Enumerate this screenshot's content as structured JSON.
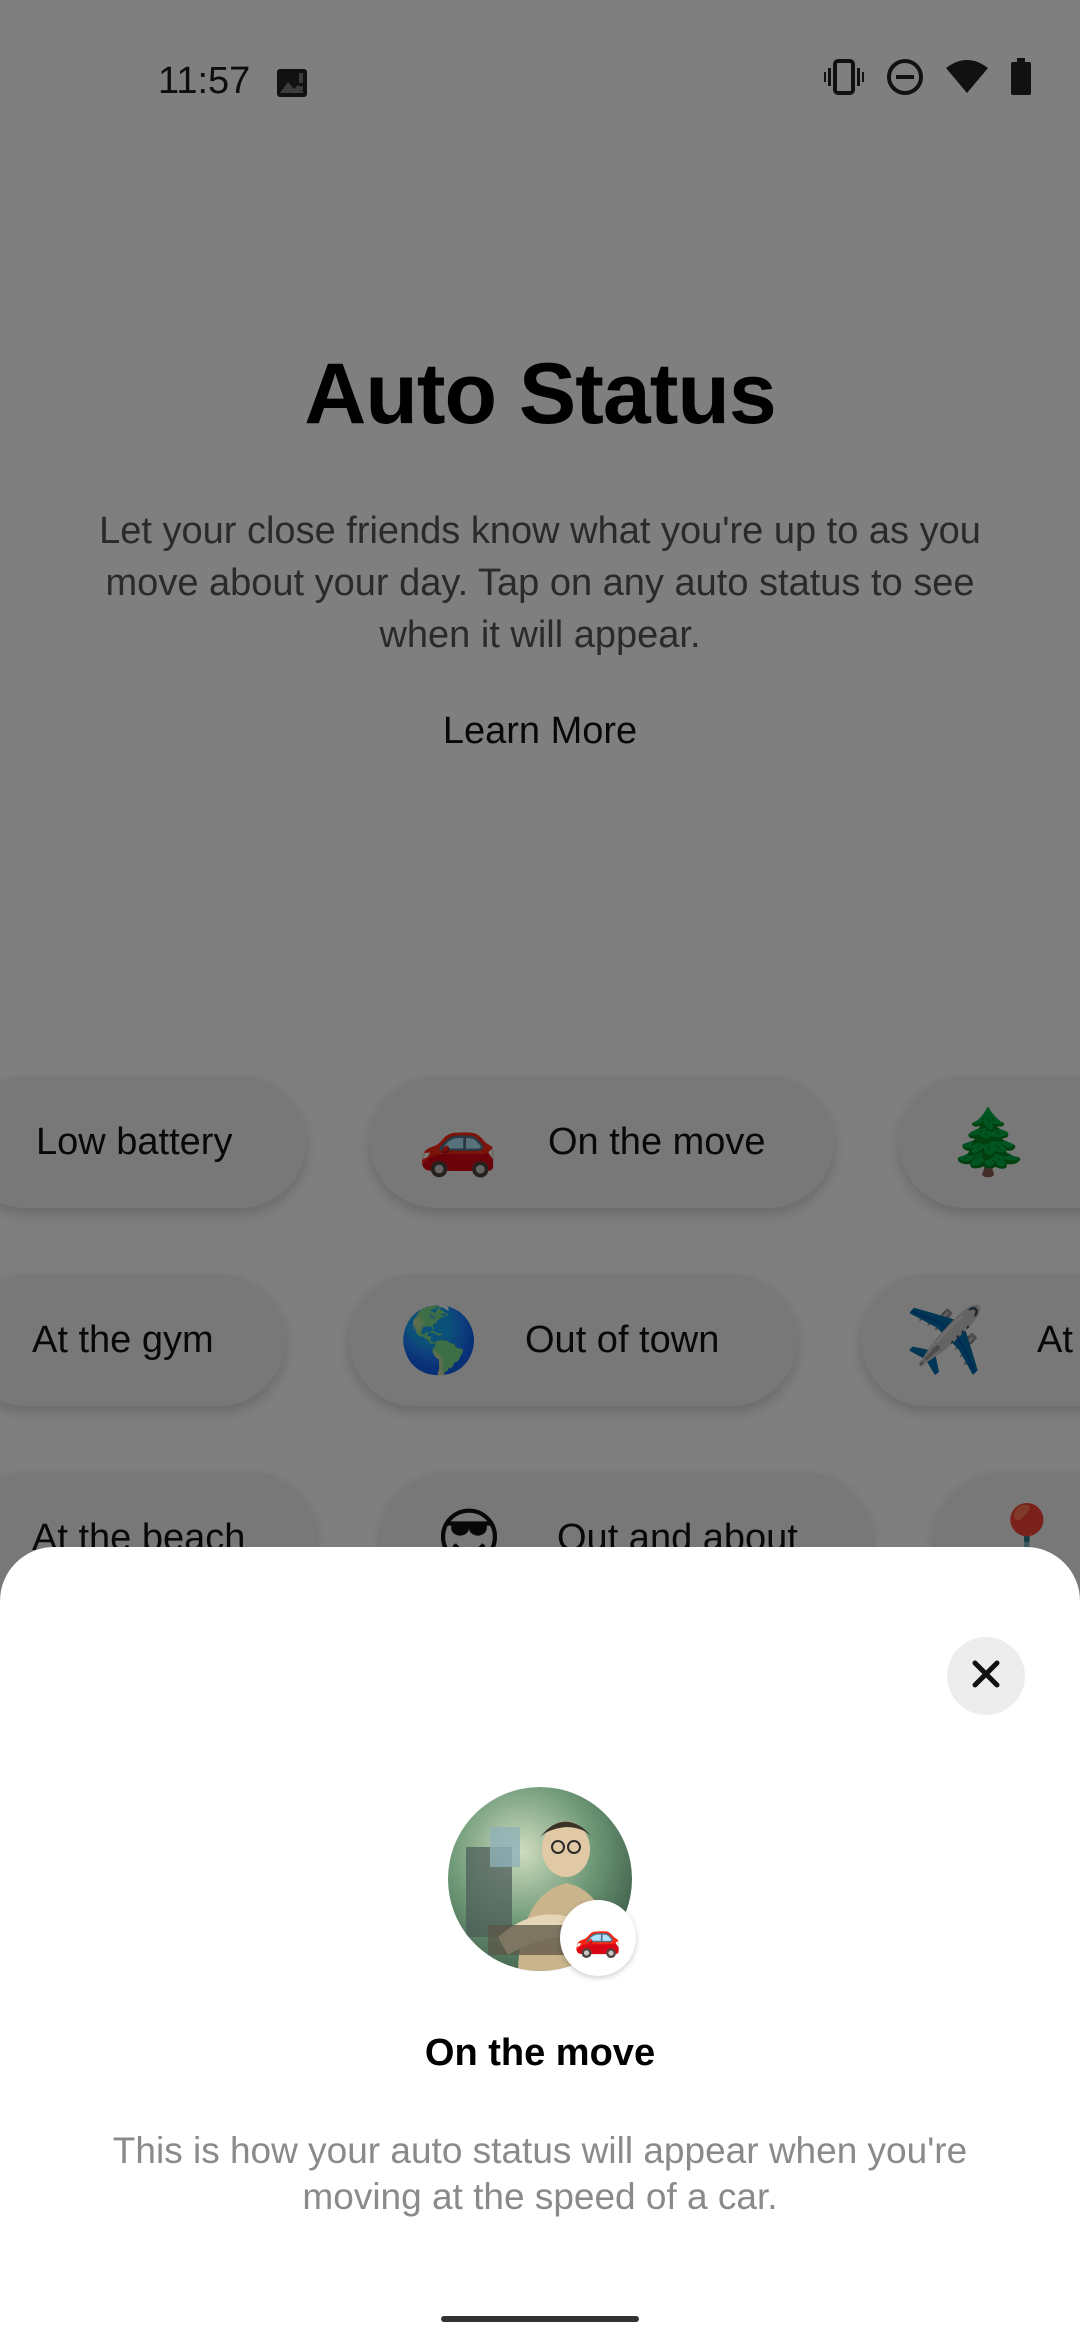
{
  "status_bar": {
    "time": "11:57",
    "icons": [
      "image-notification-icon",
      "vibrate-icon",
      "do-not-disturb-icon",
      "wifi-icon",
      "battery-icon"
    ]
  },
  "page": {
    "title": "Auto Status",
    "description": "Let your close friends know what you're up to as you move about your day. Tap on any auto status to see when it will appear.",
    "learn_more": "Learn More"
  },
  "statuses": {
    "row1": [
      {
        "label": "Low battery",
        "emoji": ""
      },
      {
        "label": "On the move",
        "emoji": "🚗"
      },
      {
        "label": "",
        "emoji": "🌲"
      }
    ],
    "row2": [
      {
        "label": "At the gym",
        "emoji": ""
      },
      {
        "label": "Out of town",
        "emoji": "🌎"
      },
      {
        "label": "At",
        "emoji": "✈️"
      }
    ],
    "row3": [
      {
        "label": "At the beach",
        "emoji": ""
      },
      {
        "label": "Out and about",
        "emoji": "😎"
      },
      {
        "label": "",
        "emoji": "📍"
      }
    ]
  },
  "sheet": {
    "title": "On the move",
    "description": "This is how your auto status will appear when you're moving at the speed of a car.",
    "badge_emoji": "🚗",
    "close_icon": "close-icon"
  },
  "colors": {
    "scrim": "#000000",
    "sheet_bg": "#ffffff",
    "pill_bg": "#f1f1f1",
    "muted_text": "#8a8a8a"
  }
}
